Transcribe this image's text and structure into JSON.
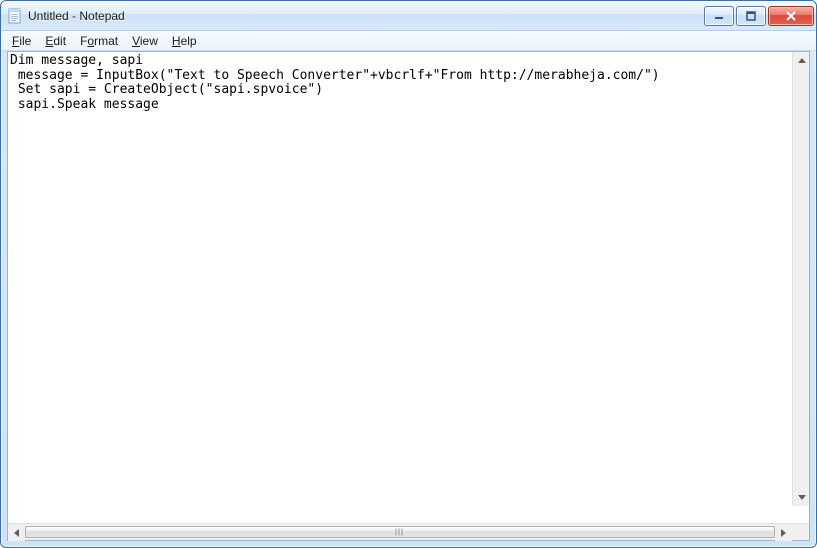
{
  "window": {
    "title": "Untitled - Notepad"
  },
  "menu": {
    "file": {
      "label": "File",
      "mn": "F"
    },
    "edit": {
      "label": "Edit",
      "mn": "E"
    },
    "format": {
      "label": "Format",
      "mn": "o"
    },
    "view": {
      "label": "View",
      "mn": "V"
    },
    "help": {
      "label": "Help",
      "mn": "H"
    }
  },
  "editor": {
    "content": "Dim message, sapi\n message = InputBox(\"Text to Speech Converter\"+vbcrlf+\"From http://merabheja.com/\")\n Set sapi = CreateObject(\"sapi.spvoice\")\n sapi.Speak message"
  },
  "colors": {
    "frame": "#d7e8f9",
    "close_btn": "#d94b3e",
    "border": "#3a6ea5"
  }
}
